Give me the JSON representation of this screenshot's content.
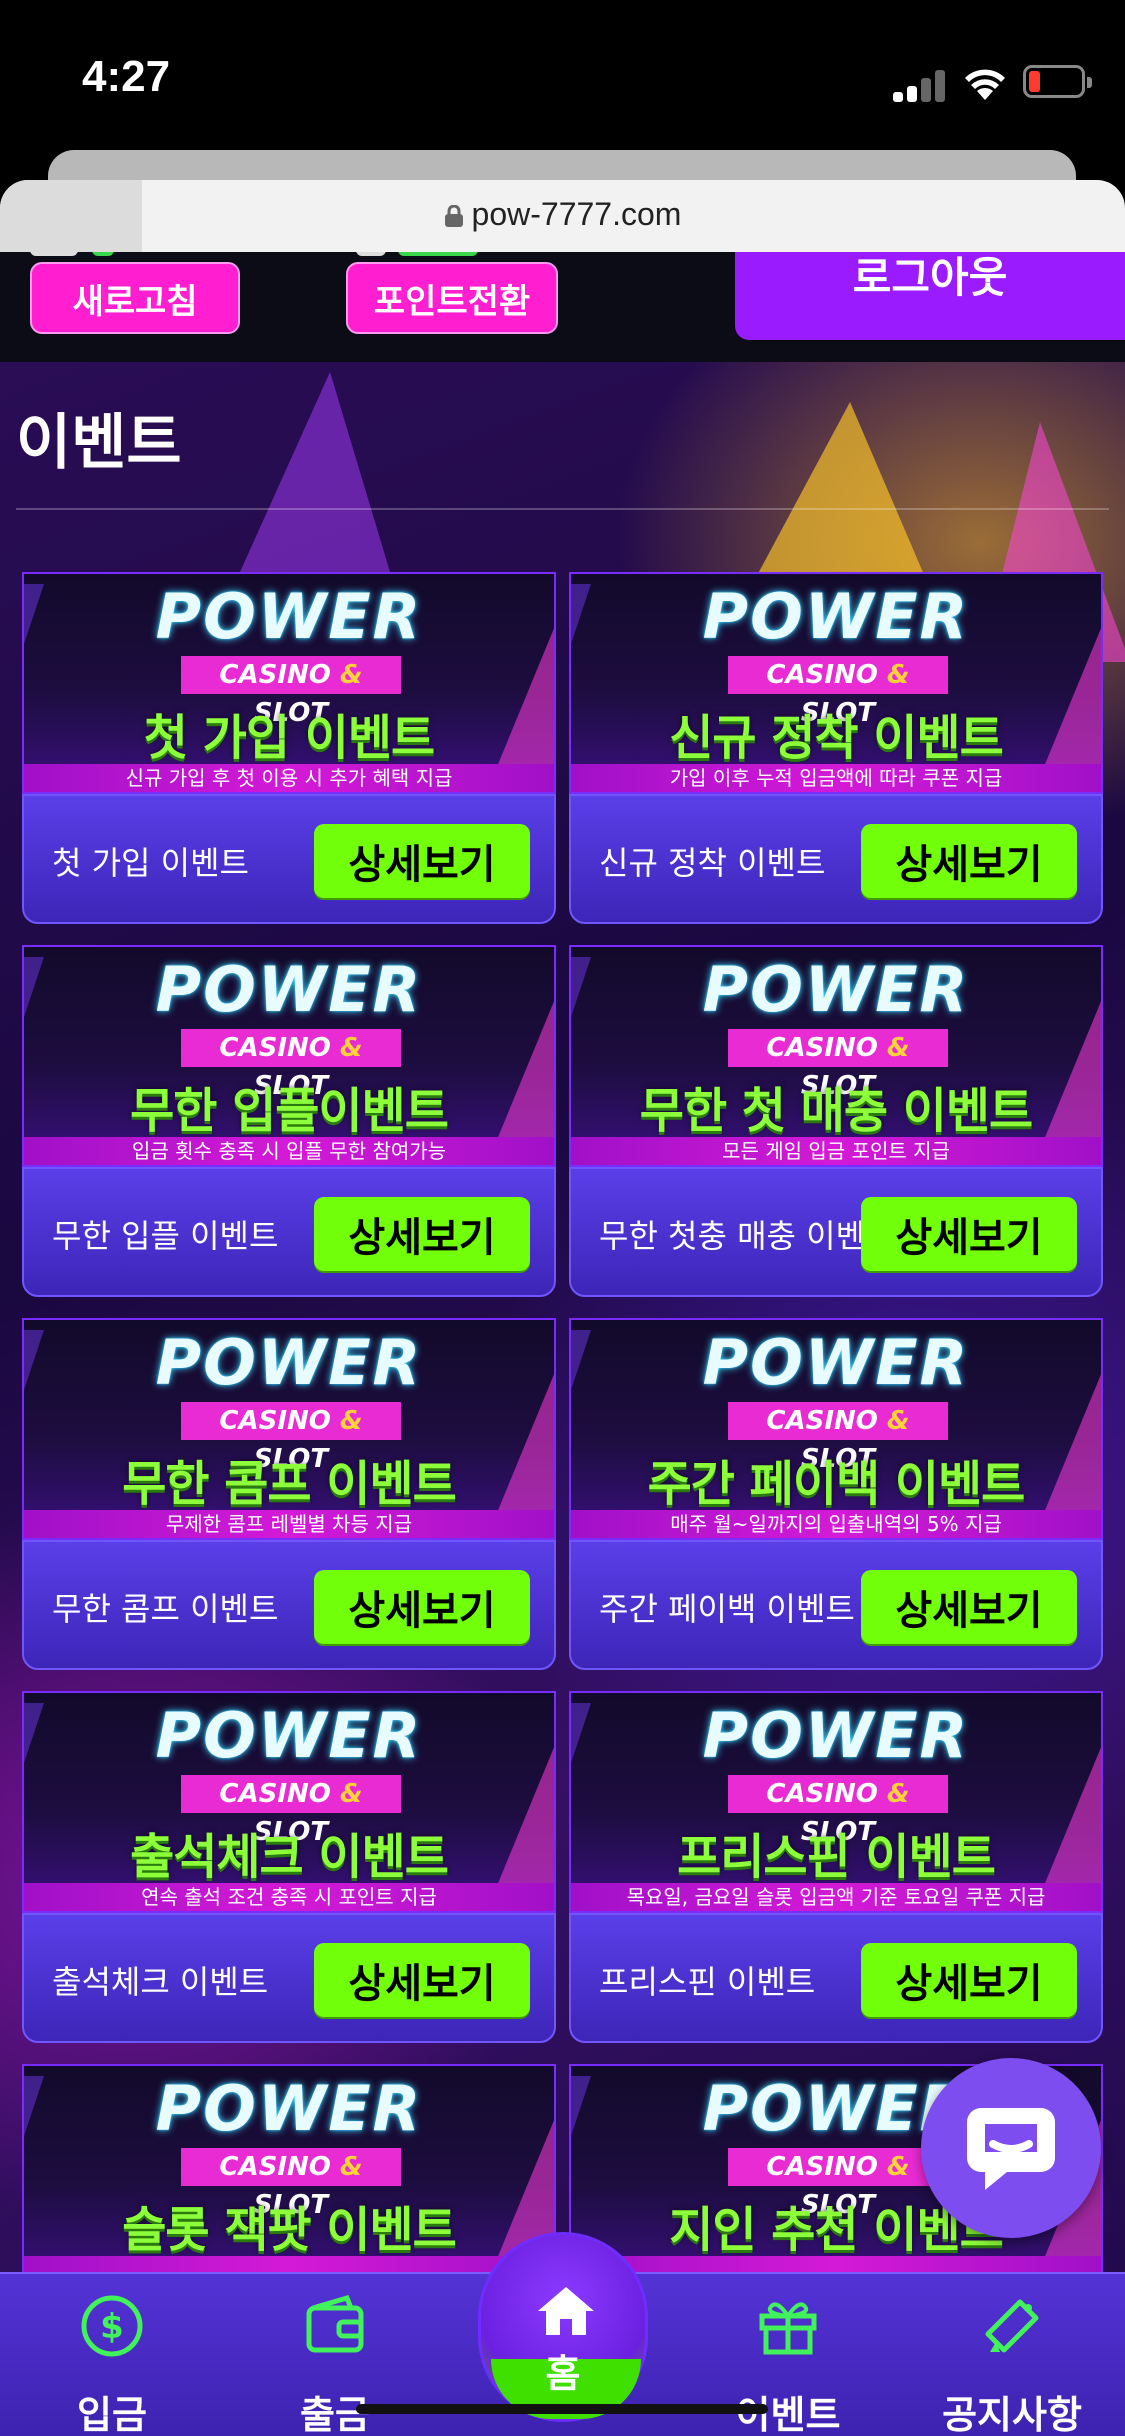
{
  "status_bar": {
    "time": "4:27"
  },
  "browser": {
    "url": "pow-7777.com"
  },
  "top_bar": {
    "refresh_label": "새로고침",
    "points_label": "포인트전환",
    "logout_label": "로그아웃"
  },
  "page": {
    "title": "이벤트"
  },
  "banner_common": {
    "brand": "POWER",
    "casino": "CASINO",
    "amp": "&",
    "slot": "SLOT"
  },
  "detail_label": "상세보기",
  "events": [
    {
      "banner_title": "첫 가입 이벤트",
      "banner_sub": "신규 가입 후 첫 이용 시 추가 혜택 지급",
      "label": "첫 가입 이벤트"
    },
    {
      "banner_title": "신규 정착 이벤트",
      "banner_sub": "가입 이후 누적 입금액에 따라 쿠폰 지급",
      "label": "신규 정착 이벤트"
    },
    {
      "banner_title": "무한 입플이벤트",
      "banner_sub": "입금 횟수 충족 시 입플 무한 참여가능",
      "label": "무한 입플 이벤트"
    },
    {
      "banner_title": "무한 첫 매충 이벤트",
      "banner_sub": "모든 게임 입금 포인트 지급",
      "label": "무한 첫충 매충 이벤트"
    },
    {
      "banner_title": "무한 콤프 이벤트",
      "banner_sub": "무제한 콤프 레벨별 차등 지급",
      "label": "무한 콤프 이벤트"
    },
    {
      "banner_title": "주간 페이백 이벤트",
      "banner_sub": "매주 월~일까지의 입출내역의 5% 지급",
      "label": "주간 페이백 이벤트"
    },
    {
      "banner_title": "출석체크 이벤트",
      "banner_sub": "연속 출석 조건 충족 시 포인트 지급",
      "label": "출석체크 이벤트"
    },
    {
      "banner_title": "프리스핀 이벤트",
      "banner_sub": "목요일, 금요일 슬롯 입금액 기준 토요일 쿠폰 지급",
      "label": "프리스핀 이벤트"
    },
    {
      "banner_title": "슬롯 잭팟 이벤트",
      "banner_sub": "",
      "label": ""
    },
    {
      "banner_title": "지인 추천 이벤트",
      "banner_sub": "",
      "label": ""
    }
  ],
  "bottom_nav": {
    "deposit": "입금",
    "withdraw": "출금",
    "home": "홈",
    "events": "이벤트",
    "notice": "공지사항"
  },
  "colors": {
    "accent_green": "#72ff0a",
    "accent_pink": "#ff1fd0",
    "accent_purple": "#9b1bff",
    "nav_bg": "#5433d6"
  }
}
